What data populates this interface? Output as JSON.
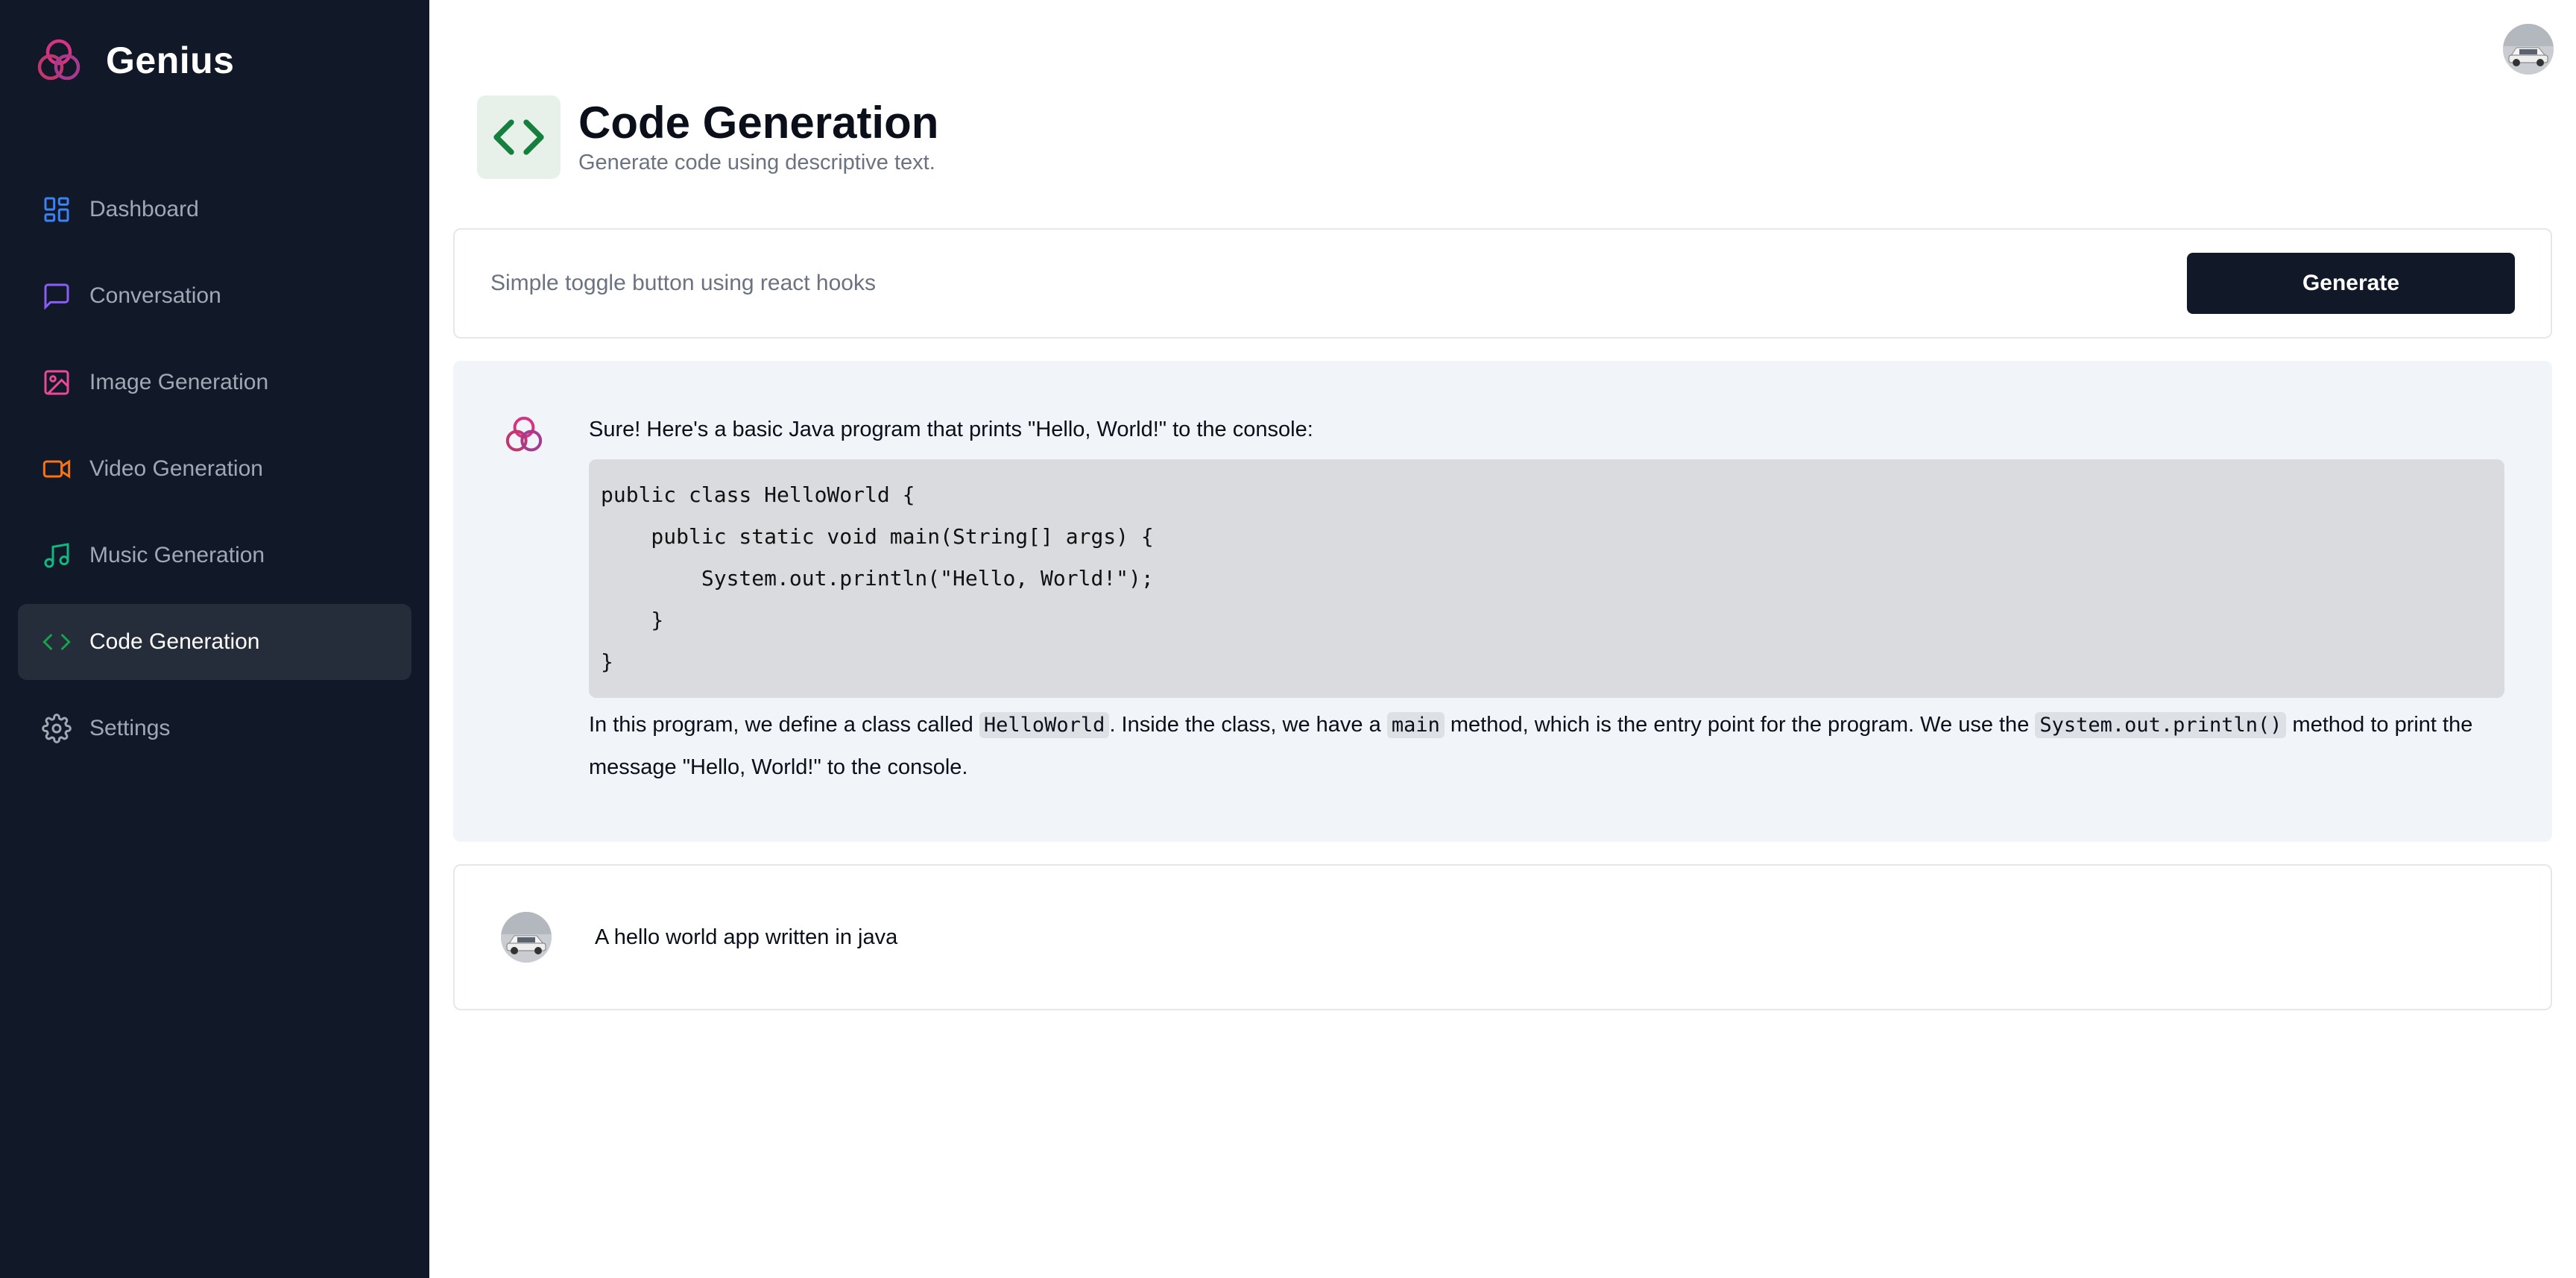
{
  "brand": {
    "name": "Genius",
    "logo_icon": "three-circles-logo-icon",
    "logo_color": "#d63384"
  },
  "sidebar": {
    "items": [
      {
        "label": "Dashboard",
        "icon": "dashboard-icon",
        "color": "#3b82f6",
        "active": false
      },
      {
        "label": "Conversation",
        "icon": "chat-icon",
        "color": "#8b5cf6",
        "active": false
      },
      {
        "label": "Image Generation",
        "icon": "image-icon",
        "color": "#ec4899",
        "active": false
      },
      {
        "label": "Video Generation",
        "icon": "video-icon",
        "color": "#f97316",
        "active": false
      },
      {
        "label": "Music Generation",
        "icon": "music-icon",
        "color": "#10b981",
        "active": false
      },
      {
        "label": "Code Generation",
        "icon": "code-icon",
        "color": "#16a34a",
        "active": true
      },
      {
        "label": "Settings",
        "icon": "gear-icon",
        "color": "#a1a8b5",
        "active": false
      }
    ]
  },
  "header": {
    "title": "Code Generation",
    "subtitle": "Generate code using descriptive text.",
    "icon": "code-icon",
    "icon_color": "#15803d",
    "icon_bg": "#e7f1ea"
  },
  "prompt": {
    "placeholder": "Simple toggle button using react hooks",
    "value": "",
    "button_label": "Generate"
  },
  "messages": {
    "bot": {
      "intro": "Sure! Here's a basic Java program that prints \"Hello, World!\" to the console:",
      "code": "public class HelloWorld {\n    public static void main(String[] args) {\n        System.out.println(\"Hello, World!\");\n    }\n}",
      "explanation_parts": {
        "p1": "In this program, we define a class called ",
        "c1": "HelloWorld",
        "p2": ". Inside the class, we have a ",
        "c2": "main",
        "p3": " method, which is the entry point for the program. We use the ",
        "c3": "System.out.println()",
        "p4": " method to print the message \"Hello, World!\" to the console."
      }
    },
    "user": {
      "text": "A hello world app written in java"
    }
  }
}
